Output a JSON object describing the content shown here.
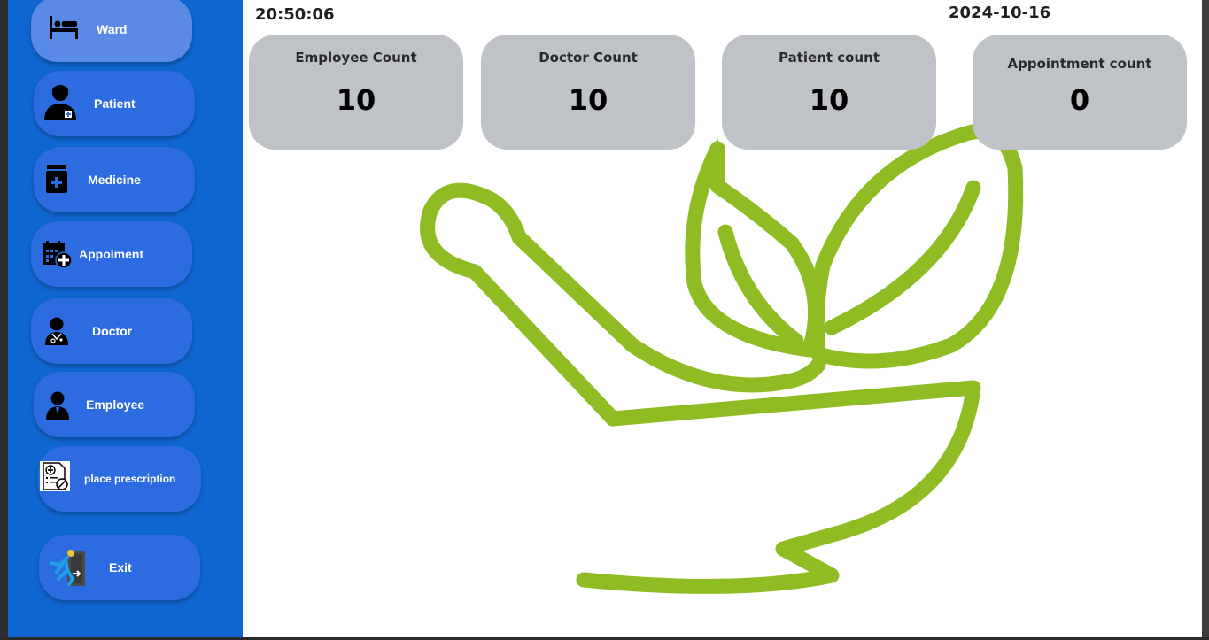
{
  "sidebar": {
    "items": [
      {
        "label": "Ward",
        "icon": "bed-icon"
      },
      {
        "label": "Patient",
        "icon": "patient-icon"
      },
      {
        "label": "Medicine",
        "icon": "medicine-icon"
      },
      {
        "label": "Appoiment",
        "icon": "appointment-calendar-icon"
      },
      {
        "label": "Doctor",
        "icon": "doctor-icon"
      },
      {
        "label": "Employee",
        "icon": "employee-icon"
      },
      {
        "label": "place prescription",
        "icon": "prescription-icon"
      },
      {
        "label": "Exit",
        "icon": "exit-icon"
      }
    ]
  },
  "header": {
    "time": "20:50:06",
    "date": "2024-10-16"
  },
  "stats": [
    {
      "title": "Employee Count",
      "value": "10"
    },
    {
      "title": "Doctor Count",
      "value": "10"
    },
    {
      "title": "Patient count",
      "value": "10"
    },
    {
      "title": "Appointment count",
      "value": "0"
    }
  ],
  "colors": {
    "sidebar": "#0e66d0",
    "button": "#2c6be0",
    "button_active": "#5a8ae6",
    "card": "#bfc3c7",
    "logo_green": "#8fbc22"
  },
  "background_logo": "mortar-pestle-leaf-logo"
}
